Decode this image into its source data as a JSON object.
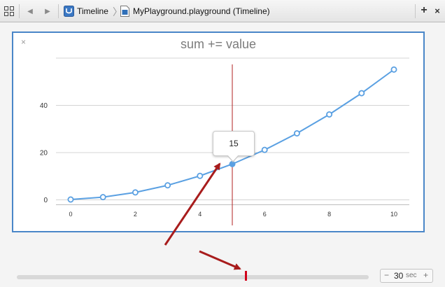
{
  "toolbar": {
    "breadcrumb_root": "Timeline",
    "breadcrumb_separator": "〉",
    "breadcrumb_file": "MyPlayground.playground (Timeline)",
    "icons": [
      "grid-icon",
      "back-arrow-icon",
      "forward-arrow-icon",
      "timeline-icon",
      "playground-file-icon",
      "add-icon",
      "close-icon"
    ]
  },
  "panel": {
    "close_glyph": "×",
    "accent_color": "#4a86c8"
  },
  "tooltip": {
    "value": "15"
  },
  "scrubber": {
    "playhead_fraction": 0.65,
    "duration_value": "30",
    "duration_unit": "sec",
    "minus": "−",
    "plus": "+"
  },
  "annotations": {
    "arrow_color": "#a81c1c",
    "count": 2
  },
  "chart_data": {
    "type": "line",
    "title": "sum += value",
    "x": [
      0,
      1,
      2,
      3,
      4,
      5,
      6,
      7,
      8,
      9,
      10
    ],
    "series": [
      {
        "values": [
          0,
          1,
          3,
          6,
          10,
          15,
          21,
          28,
          36,
          45,
          55
        ],
        "color": "#5aa0e2"
      }
    ],
    "x_ticks": [
      0,
      2,
      4,
      6,
      8,
      10
    ],
    "y_ticks": [
      0,
      20,
      40
    ],
    "xlim": [
      -0.1,
      10.1
    ],
    "ylim": [
      -3,
      57
    ],
    "grid": true,
    "highlight_x": 5,
    "highlight_color": "#b22222",
    "xlabel": "",
    "ylabel": ""
  }
}
